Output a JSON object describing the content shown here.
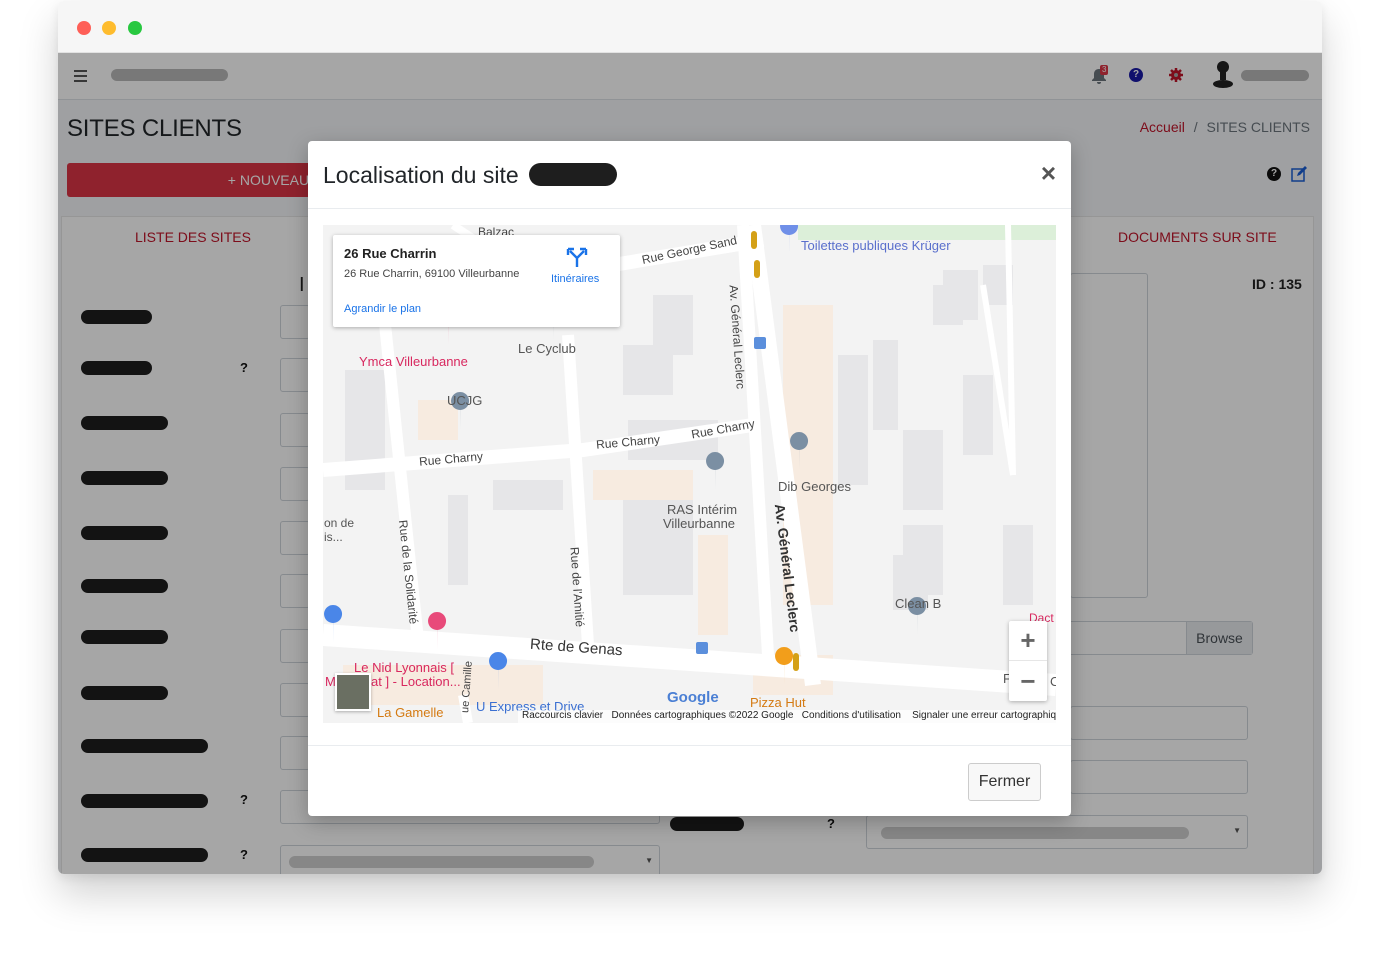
{
  "app": {
    "page_title": "SITES CLIENTS",
    "breadcrumb_home": "Accueil",
    "breadcrumb_separator": "/",
    "breadcrumb_current": "SITES CLIENTS",
    "new_button": "+ NOUVEAU SI",
    "tab_sites": "LISTE DES SITES",
    "tab_documents": "DOCUMENTS SUR SITE",
    "record_id": "ID : 135",
    "browse_button": "Browse",
    "notification_count": "3",
    "question_mark": "?",
    "partial_heading": "I",
    "colors": {
      "accent": "#dc3545",
      "link": "#c0142a"
    }
  },
  "modal": {
    "title": "Localisation du site",
    "close_symbol": "×",
    "footer_button": "Fermer"
  },
  "map": {
    "info": {
      "place_name": "26 Rue Charrin",
      "address": "26 Rue Charrin, 69100 Villeurbanne",
      "directions_label": "Itinéraires",
      "enlarge_link": "Agrandir le plan"
    },
    "streets": {
      "balzac": "Balzac",
      "george_sand": "Rue George Sand",
      "charny_left": "Rue Charny",
      "charny_mid": "Rue Charny",
      "charny_right": "Rue Charny",
      "leclerc_upper": "Av. Général Leclerc",
      "leclerc_lower": "Av. Général Leclerc",
      "solidarite": "Rue de la Solidarité",
      "amitie": "Rue de l'Amitié",
      "genas": "Rte de Genas",
      "camille": "ue Camille"
    },
    "pois": {
      "toilettes": "Toilettes publiques Krüger",
      "ymca": "Ymca Villeurbanne",
      "cyclub": "Le Cyclub",
      "ucjg": "UCJG",
      "dib": "Dib Georges",
      "ras_1": "RAS Intérim",
      "ras_2": "Villeurbanne",
      "clean": "Clean B",
      "nid_1": "Le Nid Lyonnais [",
      "nid_2": "at ] - Location...",
      "la_gamelle": "La Gamelle",
      "u_express": "U Express et Drive",
      "pizza": "Pizza Hut",
      "left_cut_1": "on de",
      "left_cut_2": "is...",
      "left_cut_3": "M",
      "right_cut_1": "Dact",
      "right_cut_2": "F",
      "right_cut_3": "C"
    },
    "brand": "Google",
    "zoom_in": "+",
    "zoom_out": "−",
    "attribution": {
      "shortcuts": "Raccourcis clavier",
      "data": "Données cartographiques ©2022 Google",
      "terms": "Conditions d'utilisation",
      "report": "Signaler une erreur cartographique"
    }
  }
}
